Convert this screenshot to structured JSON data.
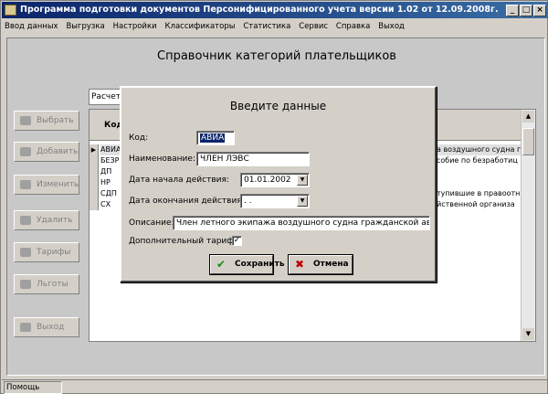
{
  "window": {
    "title": "Программа подготовки документов Персонифицированного учета версии 1.02 от 12.09.2008г.",
    "btn_min": "_",
    "btn_max": "□",
    "btn_close": "×"
  },
  "menu": [
    "Ввод данных",
    "Выгрузка",
    "Настройки",
    "Классификаторы",
    "Статистика",
    "Сервис",
    "Справка",
    "Выход"
  ],
  "main": {
    "heading": "Справочник категорий плательщиков",
    "combo_text": "Расчет",
    "grid_header": "Код",
    "rows": [
      {
        "indicator": "▶",
        "code": "АВИА",
        "desc": "а воздушного судна гр"
      },
      {
        "indicator": "",
        "code": "БЕЗР",
        "desc": "собие по безработиц"
      },
      {
        "indicator": "",
        "code": "ДП",
        "desc": ""
      },
      {
        "indicator": "",
        "code": "НР",
        "desc": ""
      },
      {
        "indicator": "",
        "code": "СДП",
        "desc": "тупившие в правоотн"
      },
      {
        "indicator": "",
        "code": "СХ",
        "desc": "йственной организа"
      }
    ]
  },
  "side_buttons": [
    {
      "label": "Выбрать"
    },
    {
      "label": "Добавить"
    },
    {
      "label": "Изменить"
    },
    {
      "label": "Удалить"
    },
    {
      "label": "Тарифы"
    },
    {
      "label": "Льготы"
    },
    {
      "label": "Выход"
    }
  ],
  "dialog": {
    "title": "Введите данные",
    "labels": {
      "code": "Код:",
      "name": "Наименование:",
      "start": "Дата начала действия:",
      "end": "Дата окончания действия:",
      "desc": "Описание:",
      "extra": "Дополнительный тариф"
    },
    "values": {
      "code": "АВИА",
      "name": "ЧЛЕН ЛЭВС",
      "start": "01.01.2002",
      "end": "  .  .",
      "desc": "Член летного экипажа воздушного судна гражданской авиации"
    },
    "extra_checked": "✓",
    "save_label": "Сохранить",
    "cancel_label": "Отмена"
  },
  "status": {
    "text": "Помощь"
  },
  "colors": {
    "titlebar": "#0a246a",
    "face": "#d4d0c8",
    "save_icon": "#1a8a1a",
    "cancel_icon": "#c00000"
  }
}
